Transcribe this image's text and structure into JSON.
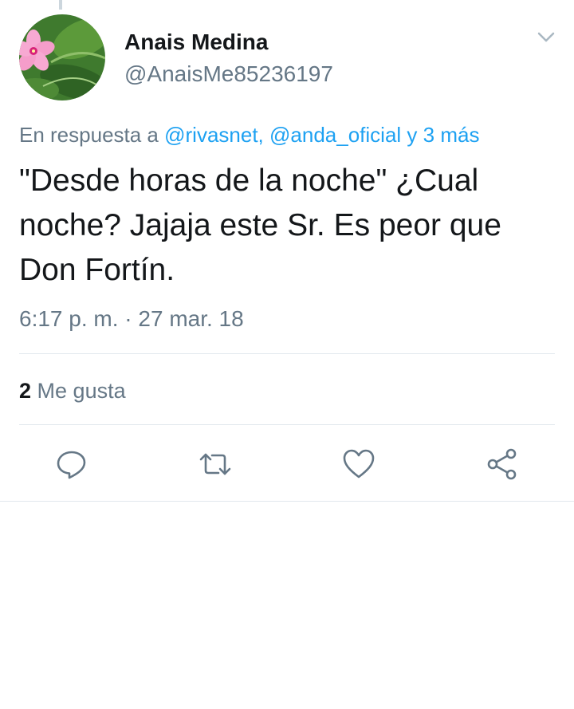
{
  "tweet": {
    "author": {
      "display_name": "Anais Medina",
      "handle": "@AnaisMe85236197"
    },
    "reply_context": {
      "prefix": "En respuesta a",
      "mention_1": "@rivasnet,",
      "mention_2": "@anda_oficial",
      "more": "y 3 más"
    },
    "text": "\"Desde horas de la noche\" ¿Cual noche? Jajaja este Sr. Es peor que Don Fortín.",
    "timestamp": "6:17 p. m. · 27 mar. 18",
    "likes": {
      "count": "2",
      "label": "Me gusta"
    }
  },
  "icons": {
    "caret": "chevron-down-icon",
    "reply": "reply-icon",
    "retweet": "retweet-icon",
    "like": "heart-icon",
    "share": "share-icon"
  },
  "colors": {
    "link": "#1da1f2",
    "secondary_text": "#657786",
    "primary_text": "#14171a",
    "divider": "#e1e8ed"
  }
}
